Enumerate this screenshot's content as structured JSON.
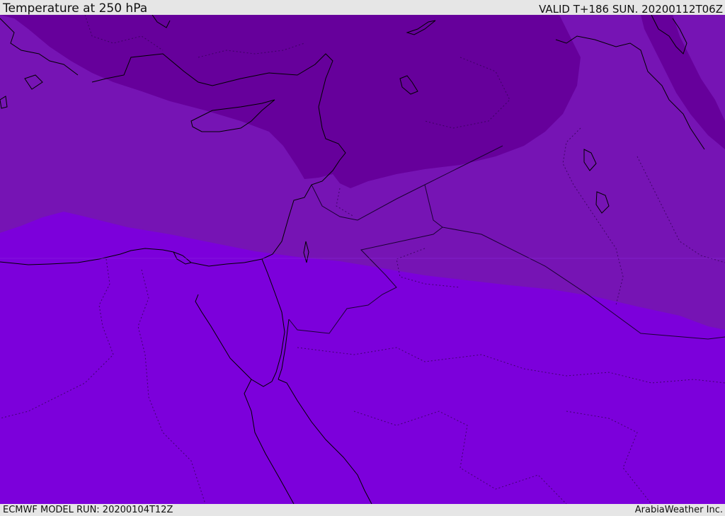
{
  "header": {
    "title": "Temperature at 250 hPa",
    "valid_time": "VALID T+186 SUN. 20200112T06Z"
  },
  "footer": {
    "model_run": "ECMWF MODEL RUN: 20200104T12Z",
    "credit": "ArabiaWeather Inc."
  },
  "map": {
    "colors": {
      "band_coldest": "#66009b",
      "band_cold": "#7614b4",
      "band_mild": "#7c00db",
      "coastline": "#000000",
      "border": "#1a0033"
    }
  }
}
